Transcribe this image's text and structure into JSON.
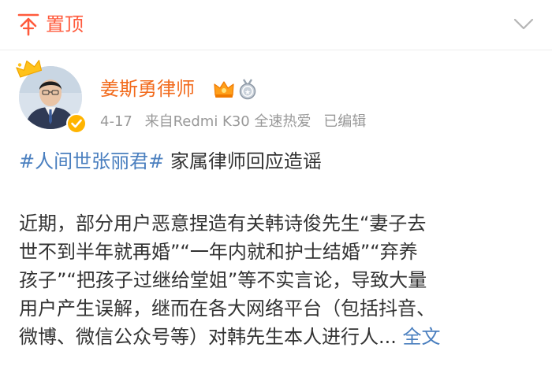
{
  "header": {
    "pin_label": "置顶"
  },
  "post": {
    "author": "姜斯勇律师",
    "date": "4-17",
    "source": "来自Redmi K30 全速热爱",
    "edited": "已编辑",
    "hashtag": "#人间世张丽君#",
    "headline": "家属律师回应造谣",
    "body_lines": [
      "近期，部分用户恶意捏造有关韩诗俊先生“妻子去",
      "世不到半年就再婚”“一年内就和护士结婚”“弃养",
      "孩子”“把孩子过继给堂姐”等不实言论，导致大量",
      "用户产生误解，继而在各大网络平台（包括抖音、"
    ],
    "last_line": "微博、微信公众号等）对韩先生本人进行人...",
    "more_label": "全文"
  },
  "colors": {
    "accent_orange": "#f26b1d",
    "pin_red": "#ff5a3c",
    "link_blue": "#4a7fbf",
    "meta_gray": "#999999"
  },
  "icons": [
    "pin-top-icon",
    "chevron-down-icon",
    "crown-icon",
    "verified-icon",
    "vip-crown-icon",
    "medal-icon"
  ]
}
